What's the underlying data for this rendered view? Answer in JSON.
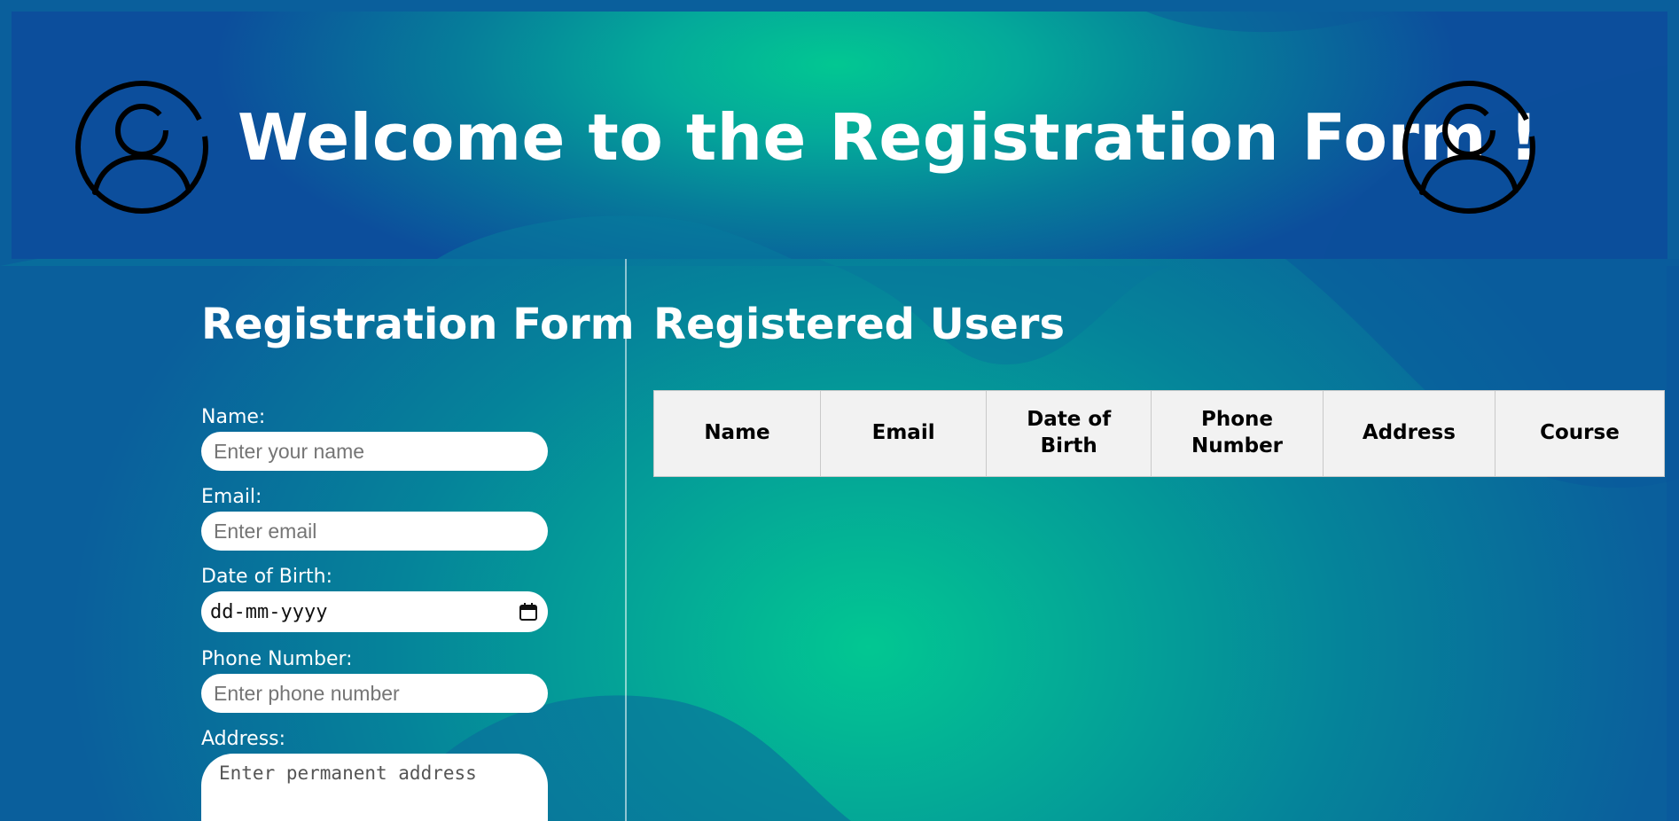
{
  "header": {
    "title": "Welcome to the Registration Form !"
  },
  "form": {
    "title": "Registration Form",
    "fields": {
      "name": {
        "label": "Name:",
        "placeholder": "Enter your name"
      },
      "email": {
        "label": "Email:",
        "placeholder": "Enter email"
      },
      "dob": {
        "label": "Date of Birth:",
        "placeholder": "dd-mm-yyyy"
      },
      "phone": {
        "label": "Phone Number:",
        "placeholder": "Enter phone number"
      },
      "address": {
        "label": "Address:",
        "placeholder": "Enter permanent address"
      }
    }
  },
  "users": {
    "title": "Registered Users",
    "columns": [
      "Name",
      "Email",
      "Date of Birth",
      "Phone Number",
      "Address",
      "Course"
    ]
  },
  "colors": {
    "accent_green": "#02c792",
    "deep_blue": "#0a5f9c",
    "table_header_bg": "#f2f2f2"
  },
  "icons": {
    "avatar": "user-avatar-icon",
    "calendar": "calendar-icon"
  }
}
